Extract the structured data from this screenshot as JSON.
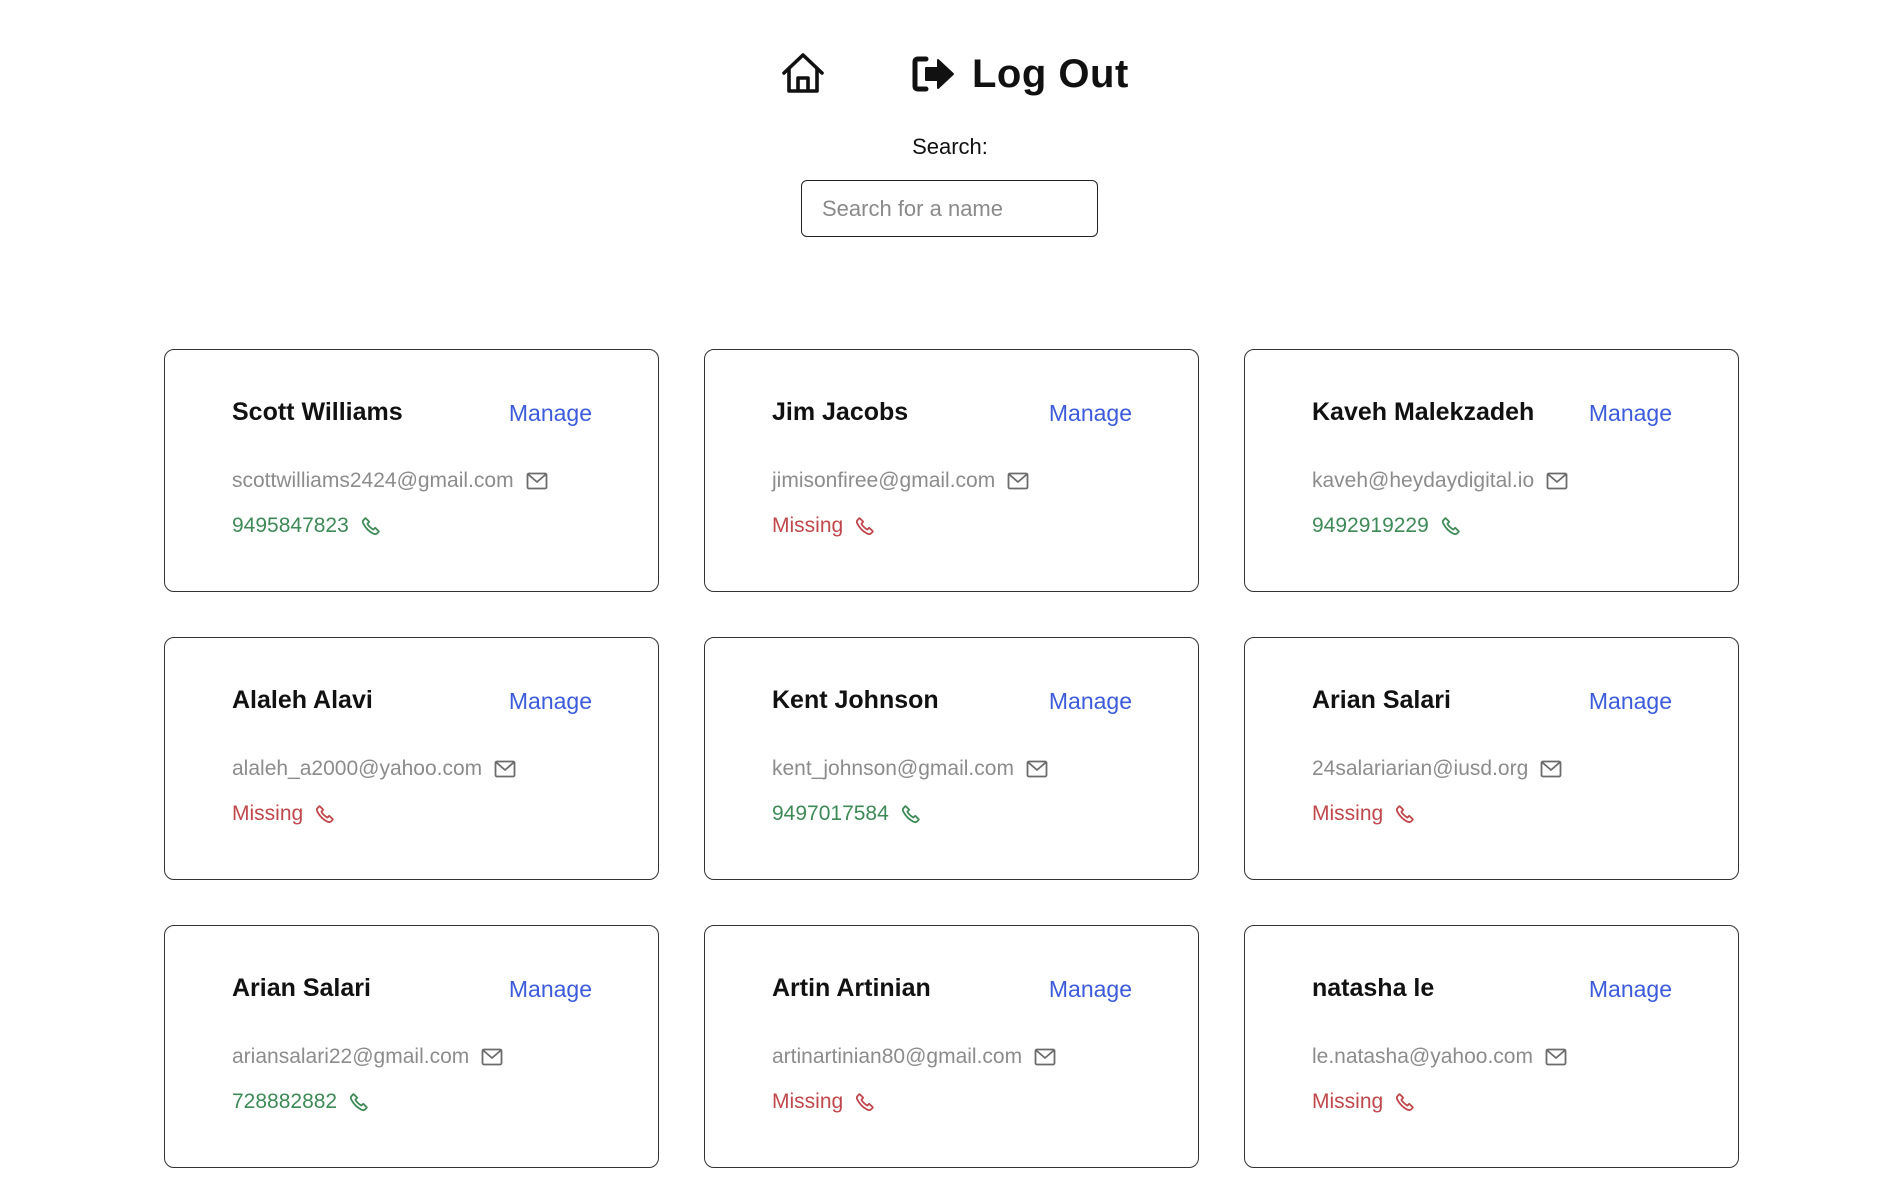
{
  "header": {
    "home_icon": "home-icon",
    "logout_icon": "sign-out-icon",
    "logout_label": "Log Out"
  },
  "search": {
    "label": "Search:",
    "placeholder": "Search for a name",
    "value": ""
  },
  "colors": {
    "link": "#3b5bdb",
    "phone_present": "#3d8a57",
    "phone_missing": "#c0474b",
    "email_text": "#8c8c8c",
    "card_border": "#333333"
  },
  "icons": {
    "email": "envelope-icon",
    "phone": "phone-icon"
  },
  "contacts": [
    {
      "name": "Scott Williams",
      "manage_label": "Manage",
      "email": "scottwilliams2424@gmail.com",
      "phone": "9495847823",
      "phone_status": "present"
    },
    {
      "name": "Jim Jacobs",
      "manage_label": "Manage",
      "email": "jimisonfiree@gmail.com",
      "phone": "Missing",
      "phone_status": "missing"
    },
    {
      "name": "Kaveh Malekzadeh",
      "manage_label": "Manage",
      "email": "kaveh@heydaydigital.io",
      "phone": "9492919229",
      "phone_status": "present"
    },
    {
      "name": "Alaleh Alavi",
      "manage_label": "Manage",
      "email": "alaleh_a2000@yahoo.com",
      "phone": "Missing",
      "phone_status": "missing"
    },
    {
      "name": "Kent Johnson",
      "manage_label": "Manage",
      "email": "kent_johnson@gmail.com",
      "phone": "9497017584",
      "phone_status": "present"
    },
    {
      "name": "Arian Salari",
      "manage_label": "Manage",
      "email": "24salariarian@iusd.org",
      "phone": "Missing",
      "phone_status": "missing"
    },
    {
      "name": "Arian Salari",
      "manage_label": "Manage",
      "email": "ariansalari22@gmail.com",
      "phone": "728882882",
      "phone_status": "present"
    },
    {
      "name": "Artin Artinian",
      "manage_label": "Manage",
      "email": "artinartinian80@gmail.com",
      "phone": "Missing",
      "phone_status": "missing"
    },
    {
      "name": "natasha le",
      "manage_label": "Manage",
      "email": "le.natasha@yahoo.com",
      "phone": "Missing",
      "phone_status": "missing"
    }
  ]
}
